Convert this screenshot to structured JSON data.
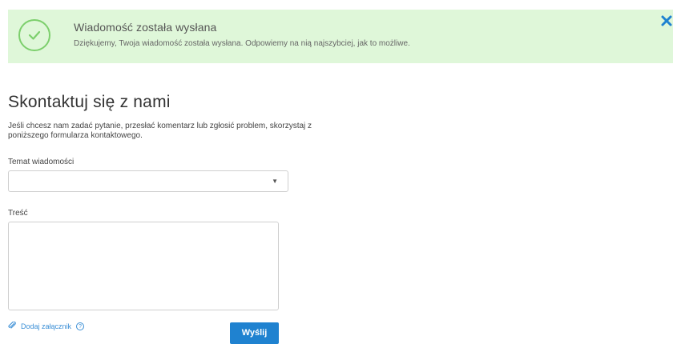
{
  "alert": {
    "icon": "check-circle-icon",
    "title": "Wiadomość została wysłana",
    "text": "Dziękujemy, Twoja wiadomość została wysłana. Odpowiemy na nią najszybciej, jak to możliwe.",
    "close_icon": "close-icon",
    "bg_color": "#dff7d9",
    "icon_color": "#7ccf6c",
    "close_color": "#1f82d0"
  },
  "form": {
    "title": "Skontaktuj się z nami",
    "intro": "Jeśli chcesz nam zadać pytanie, przesłać komentarz lub zgłosić problem, skorzystaj z poniższego formularza kontaktowego.",
    "subject_label": "Temat wiadomości",
    "subject_value": "",
    "body_label": "Treść",
    "body_value": "",
    "attach_label": "Dodaj załącznik",
    "help_glyph": "?",
    "submit_label": "Wyślij",
    "accent_color": "#1f82d0"
  }
}
